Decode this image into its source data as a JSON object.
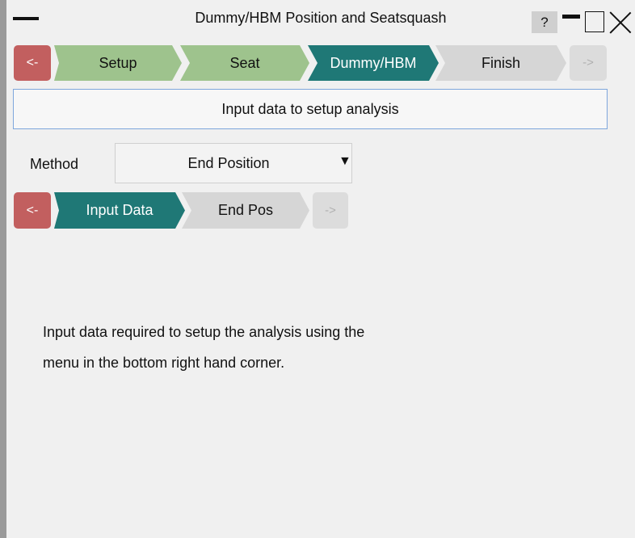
{
  "window": {
    "title": "Dummy/HBM Position and Seatsquash",
    "help_label": "?"
  },
  "wizard": {
    "back_label": "<-",
    "next_label": "->",
    "steps": [
      {
        "label": "Setup",
        "state": "done"
      },
      {
        "label": "Seat",
        "state": "done"
      },
      {
        "label": "Dummy/HBM",
        "state": "active"
      },
      {
        "label": "Finish",
        "state": "todo"
      }
    ]
  },
  "info_box": {
    "text": "Input data to setup analysis"
  },
  "method": {
    "label": "Method",
    "selected": "End Position"
  },
  "sub_wizard": {
    "back_label": "<-",
    "next_label": "->",
    "steps": [
      {
        "label": "Input Data",
        "state": "active"
      },
      {
        "label": "End Pos",
        "state": "todo"
      }
    ]
  },
  "help_text": {
    "line1": "Input data required to setup the analysis using the",
    "line2": "menu in the bottom right hand corner."
  },
  "colors": {
    "back_button": "#c25f5f",
    "done_step": "#9ec38d",
    "active_step": "#1f7876",
    "todo_step": "#d6d6d6",
    "info_border": "#7ea6dc"
  }
}
